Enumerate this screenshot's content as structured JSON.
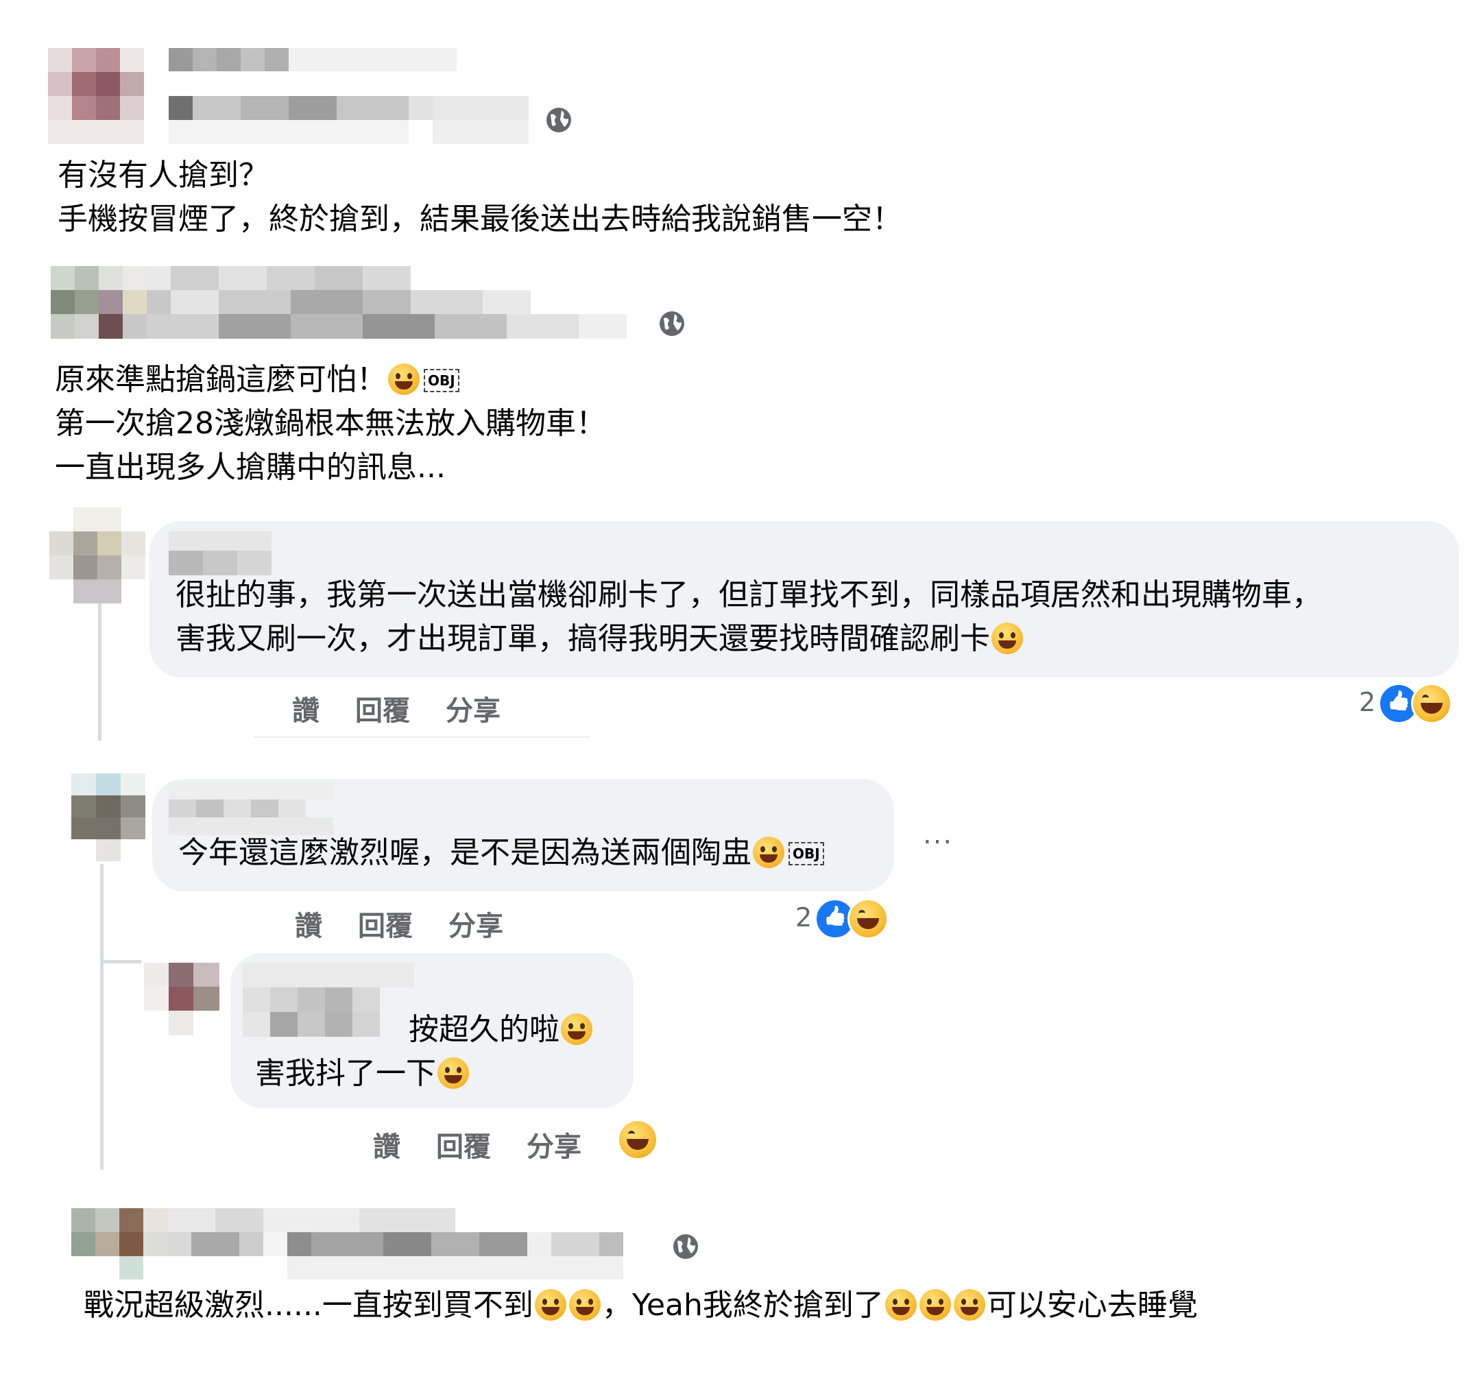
{
  "posts": [
    {
      "text_lines": [
        "有沒有人搶到？",
        "手機按冒煙了，終於搶到，結果最後送出去時給我說銷售一空！"
      ]
    },
    {
      "text_lines": [
        "原來準點搶鍋這麼可怕！",
        "第一次搶28淺燉鍋根本無法放入購物車！",
        "一直出現多人搶購中的訊息..."
      ]
    },
    {
      "text_parts": [
        "戰況超級激烈......一直按到買不到",
        "，Yeah我終於搶到了",
        "可以安心去睡覺"
      ]
    }
  ],
  "comments": [
    {
      "text_lines": [
        "很扯的事，我第一次送出當機卻刷卡了，但訂單找不到，同樣品項居然和出現購物車，",
        "害我又刷一次，才出現訂單，搞得我明天還要找時間確認刷卡"
      ],
      "reaction_count": "2"
    },
    {
      "text": "今年還這麼激烈喔，是不是因為送兩個陶盅",
      "reaction_count": "2",
      "more": "..."
    },
    {
      "text_lines": [
        "按超久的啦",
        "害我抖了一下"
      ]
    }
  ],
  "actions": {
    "like": "讚",
    "reply": "回覆",
    "share": "分享"
  },
  "obj_glyph": "OBJ",
  "icons": [
    "globe-icon",
    "like-reaction-icon",
    "haha-reaction-icon",
    "emoji-icon",
    "more-icon"
  ],
  "colors": {
    "bubble": "#f0f2f5",
    "action_text": "#65676b",
    "like_blue": "#1877f2"
  }
}
